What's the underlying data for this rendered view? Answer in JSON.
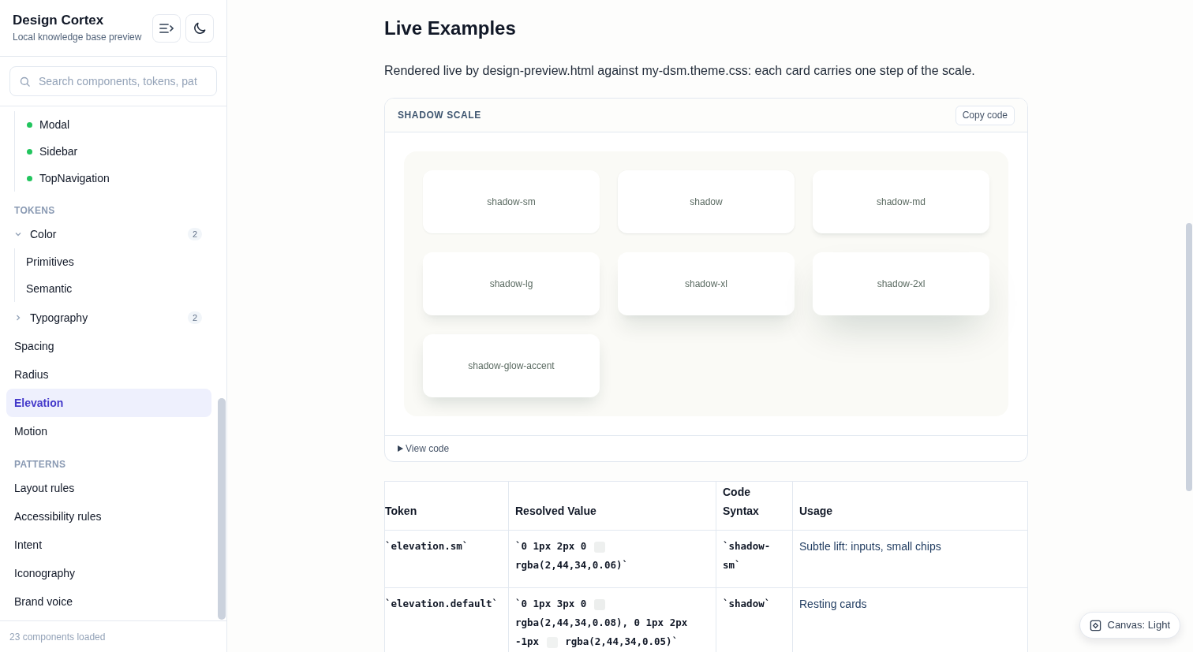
{
  "sidebar": {
    "title": "Design Cortex",
    "subtitle": "Local knowledge base preview",
    "search": {
      "placeholder": "Search components, tokens, pat"
    },
    "sections": [
      {
        "items": [
          {
            "kind": "component",
            "label": "Modal",
            "color": "#22c55e"
          },
          {
            "kind": "component",
            "label": "Sidebar",
            "color": "#22c55e"
          },
          {
            "kind": "component",
            "label": "TopNavigation",
            "color": "#22c55e"
          }
        ]
      },
      {
        "heading": "TOKENS",
        "items": [
          {
            "kind": "group",
            "label": "Color",
            "count": "2",
            "expanded": true,
            "children": [
              {
                "kind": "link",
                "label": "Primitives",
                "selected": false
              },
              {
                "kind": "link",
                "label": "Semantic",
                "selected": false
              }
            ]
          },
          {
            "kind": "group",
            "label": "Typography",
            "count": "2",
            "expanded": false
          },
          {
            "kind": "link",
            "label": "Spacing",
            "selected": false
          },
          {
            "kind": "link",
            "label": "Radius",
            "selected": false
          },
          {
            "kind": "link",
            "label": "Elevation",
            "selected": true
          },
          {
            "kind": "link",
            "label": "Motion",
            "selected": false
          }
        ]
      },
      {
        "heading": "PATTERNS",
        "items": [
          {
            "kind": "link",
            "label": "Layout rules",
            "selected": false
          },
          {
            "kind": "link",
            "label": "Accessibility rules",
            "selected": false
          },
          {
            "kind": "link",
            "label": "Intent",
            "selected": false
          },
          {
            "kind": "link",
            "label": "Iconography",
            "selected": false
          },
          {
            "kind": "link",
            "label": "Brand voice",
            "selected": false
          }
        ]
      }
    ],
    "footer": "23 components loaded"
  },
  "main": {
    "heading": "Live Examples",
    "intro": "Rendered live by design-preview.html against my-dsm.theme.css: each card carries one step of the scale.",
    "example": {
      "title": "SHADOW SCALE",
      "copy_button": "Copy code",
      "cards": [
        {
          "label": "shadow-sm"
        },
        {
          "label": "shadow"
        },
        {
          "label": "shadow-md"
        },
        {
          "label": "shadow-lg"
        },
        {
          "label": "shadow-xl"
        },
        {
          "label": "shadow-2xl"
        },
        {
          "label": "shadow-glow-accent"
        }
      ],
      "view_code": "View code"
    },
    "table": {
      "columns": [
        "Token",
        "Resolved Value",
        "Code Syntax",
        "Usage"
      ],
      "rows": [
        {
          "token": "`elevation.sm`",
          "value": [
            {
              "kind": "text",
              "text": "`0 1px 2px 0"
            },
            {
              "kind": "swatch",
              "color": "#eef0ef"
            },
            {
              "kind": "text",
              "text": "rgba(2,44,34,0.06)`"
            }
          ],
          "syntax": "`shadow-sm`",
          "usage": "Subtle lift: inputs, small chips"
        },
        {
          "token": "`elevation.default`",
          "value": [
            {
              "kind": "text",
              "text": "`0 1px 3px 0"
            },
            {
              "kind": "swatch",
              "color": "#eceeed"
            },
            {
              "kind": "text",
              "text": "rgba(2,44,34,0.08), 0 1px 2px -1px"
            },
            {
              "kind": "swatch",
              "color": "#f0f2f1"
            },
            {
              "kind": "text",
              "text": "rgba(2,44,34,0.05)`"
            }
          ],
          "syntax": "`shadow`",
          "usage": "Resting cards"
        }
      ]
    }
  },
  "canvas_toggle": {
    "label": "Canvas: Light"
  }
}
